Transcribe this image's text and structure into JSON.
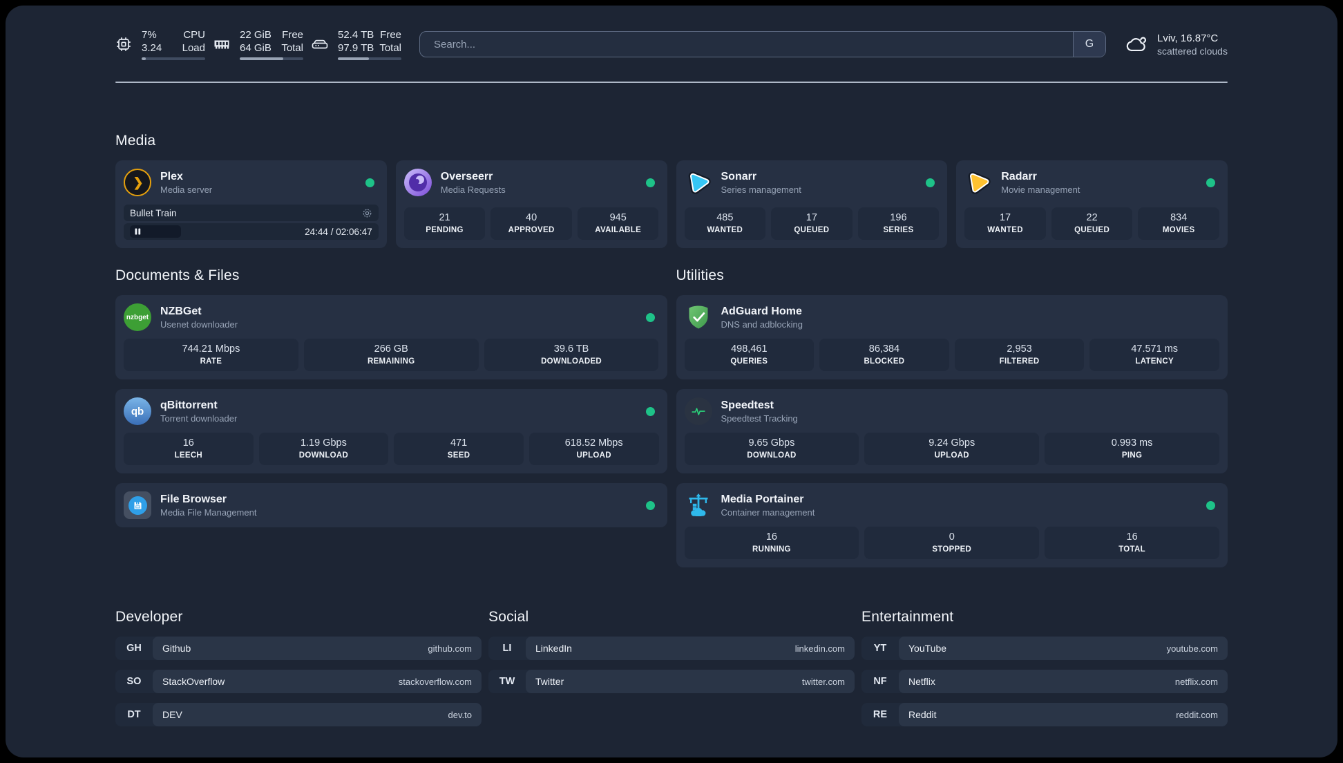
{
  "topbar": {
    "resources": [
      {
        "icon": "cpu-icon",
        "value_top": "7%",
        "value_bottom": "3.24",
        "label_top": "CPU",
        "label_bottom": "Load",
        "progress_pct": 7
      },
      {
        "icon": "memory-icon",
        "value_top": "22 GiB",
        "value_bottom": "64 GiB",
        "label_top": "Free",
        "label_bottom": "Total",
        "progress_pct": 68
      },
      {
        "icon": "disk-icon",
        "value_top": "52.4 TB",
        "value_bottom": "97.9 TB",
        "label_top": "Free",
        "label_bottom": "Total",
        "progress_pct": 49
      }
    ],
    "search": {
      "placeholder": "Search...",
      "button_label": "G"
    },
    "weather": {
      "icon": "cloud-icon",
      "line1": "Lviv, 16.87°C",
      "line2": "scattered clouds"
    }
  },
  "sections": {
    "media": {
      "title": "Media",
      "services": [
        {
          "icon": "plex-icon",
          "name": "Plex",
          "desc": "Media server",
          "status": "online",
          "player": {
            "title": "Bullet Train",
            "time": "24:44 / 02:06:47",
            "state": "paused"
          }
        },
        {
          "icon": "overseerr-icon",
          "name": "Overseerr",
          "desc": "Media Requests",
          "status": "online",
          "stats": [
            {
              "value": "21",
              "label": "PENDING"
            },
            {
              "value": "40",
              "label": "APPROVED"
            },
            {
              "value": "945",
              "label": "AVAILABLE"
            }
          ]
        },
        {
          "icon": "sonarr-icon",
          "name": "Sonarr",
          "desc": "Series management",
          "status": "online",
          "stats": [
            {
              "value": "485",
              "label": "WANTED"
            },
            {
              "value": "17",
              "label": "QUEUED"
            },
            {
              "value": "196",
              "label": "SERIES"
            }
          ]
        },
        {
          "icon": "radarr-icon",
          "name": "Radarr",
          "desc": "Movie management",
          "status": "online",
          "stats": [
            {
              "value": "17",
              "label": "WANTED"
            },
            {
              "value": "22",
              "label": "QUEUED"
            },
            {
              "value": "834",
              "label": "MOVIES"
            }
          ]
        }
      ]
    },
    "documents": {
      "title": "Documents & Files",
      "services": [
        {
          "icon": "nzbget-icon",
          "name": "NZBGet",
          "desc": "Usenet downloader",
          "status": "online",
          "stats": [
            {
              "value": "744.21 Mbps",
              "label": "RATE"
            },
            {
              "value": "266 GB",
              "label": "REMAINING"
            },
            {
              "value": "39.6 TB",
              "label": "DOWNLOADED"
            }
          ]
        },
        {
          "icon": "qbittorrent-icon",
          "name": "qBittorrent",
          "desc": "Torrent downloader",
          "status": "online",
          "stats": [
            {
              "value": "16",
              "label": "LEECH"
            },
            {
              "value": "1.19 Gbps",
              "label": "DOWNLOAD"
            },
            {
              "value": "471",
              "label": "SEED"
            },
            {
              "value": "618.52 Mbps",
              "label": "UPLOAD"
            }
          ]
        },
        {
          "icon": "filebrowser-icon",
          "name": "File Browser",
          "desc": "Media File Management",
          "status": "online"
        }
      ]
    },
    "utilities": {
      "title": "Utilities",
      "services": [
        {
          "icon": "adguard-icon",
          "name": "AdGuard Home",
          "desc": "DNS and adblocking",
          "stats": [
            {
              "value": "498,461",
              "label": "QUERIES"
            },
            {
              "value": "86,384",
              "label": "BLOCKED"
            },
            {
              "value": "2,953",
              "label": "FILTERED"
            },
            {
              "value": "47.571 ms",
              "label": "LATENCY"
            }
          ]
        },
        {
          "icon": "speedtest-icon",
          "name": "Speedtest",
          "desc": "Speedtest Tracking",
          "stats": [
            {
              "value": "9.65 Gbps",
              "label": "DOWNLOAD"
            },
            {
              "value": "9.24 Gbps",
              "label": "UPLOAD"
            },
            {
              "value": "0.993 ms",
              "label": "PING"
            }
          ]
        },
        {
          "icon": "portainer-icon",
          "name": "Media Portainer",
          "desc": "Container management",
          "status": "online",
          "stats": [
            {
              "value": "16",
              "label": "RUNNING"
            },
            {
              "value": "0",
              "label": "STOPPED"
            },
            {
              "value": "16",
              "label": "TOTAL"
            }
          ]
        }
      ]
    }
  },
  "bookmark_groups": [
    {
      "title": "Developer",
      "items": [
        {
          "abbr": "GH",
          "name": "Github",
          "url": "github.com"
        },
        {
          "abbr": "SO",
          "name": "StackOverflow",
          "url": "stackoverflow.com"
        },
        {
          "abbr": "DT",
          "name": "DEV",
          "url": "dev.to"
        }
      ]
    },
    {
      "title": "Social",
      "items": [
        {
          "abbr": "LI",
          "name": "LinkedIn",
          "url": "linkedin.com"
        },
        {
          "abbr": "TW",
          "name": "Twitter",
          "url": "twitter.com"
        }
      ]
    },
    {
      "title": "Entertainment",
      "items": [
        {
          "abbr": "YT",
          "name": "YouTube",
          "url": "youtube.com"
        },
        {
          "abbr": "NF",
          "name": "Netflix",
          "url": "netflix.com"
        },
        {
          "abbr": "RE",
          "name": "Reddit",
          "url": "reddit.com"
        }
      ]
    }
  ],
  "colors": {
    "status_online": "#1ec288",
    "plex_amber": "#e5a00d",
    "sonarr_blue": "#36c6f4",
    "radarr_amber": "#ffc230",
    "nzbget_green": "#3d9f35",
    "qbittorrent_blue": "#4a90d9",
    "adguard_green": "#67b279",
    "portainer_blue": "#2fb9ec",
    "speedtest_pulse": "#2ad37a"
  }
}
